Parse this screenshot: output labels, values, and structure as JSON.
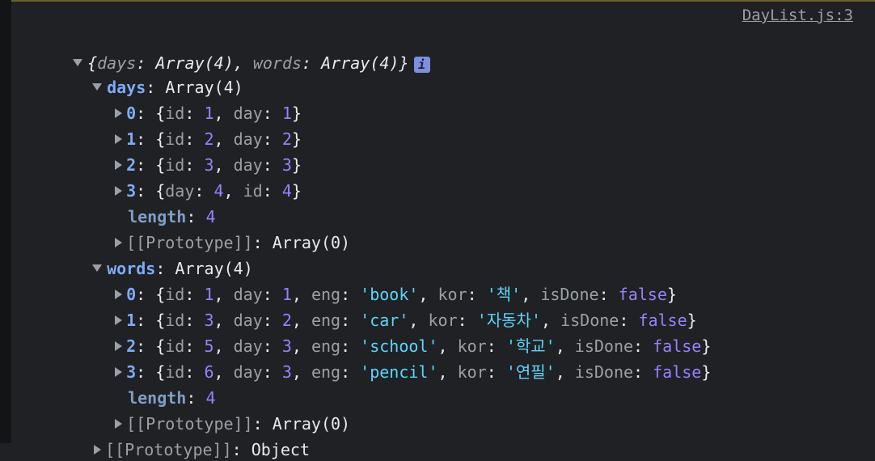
{
  "source_link": "DayList.js:3",
  "root_summary": {
    "open": "{",
    "days_key": "days",
    "days_val": "Array(4)",
    "words_key": "words",
    "words_val": "Array(4)",
    "close": "}",
    "info_icon": "i"
  },
  "days": {
    "key": "days",
    "value": "Array(4)",
    "items": [
      {
        "index": "0",
        "k1": "id",
        "v1": "1",
        "k2": "day",
        "v2": "1"
      },
      {
        "index": "1",
        "k1": "id",
        "v1": "2",
        "k2": "day",
        "v2": "2"
      },
      {
        "index": "2",
        "k1": "id",
        "v1": "3",
        "k2": "day",
        "v2": "3"
      },
      {
        "index": "3",
        "k1": "day",
        "v1": "4",
        "k2": "id",
        "v2": "4"
      }
    ],
    "length_key": "length",
    "length_val": "4",
    "proto_key": "[[Prototype]]",
    "proto_val": "Array(0)"
  },
  "words": {
    "key": "words",
    "value": "Array(4)",
    "items": [
      {
        "index": "0",
        "id": "1",
        "day": "1",
        "eng": "'book'",
        "kor": "'책'",
        "isDone": "false"
      },
      {
        "index": "1",
        "id": "3",
        "day": "2",
        "eng": "'car'",
        "kor": "'자동차'",
        "isDone": "false"
      },
      {
        "index": "2",
        "id": "5",
        "day": "3",
        "eng": "'school'",
        "kor": "'학교'",
        "isDone": "false"
      },
      {
        "index": "3",
        "id": "6",
        "day": "3",
        "eng": "'pencil'",
        "kor": "'연필'",
        "isDone": "false"
      }
    ],
    "length_key": "length",
    "length_val": "4",
    "proto_key": "[[Prototype]]",
    "proto_val": "Array(0)"
  },
  "root_proto": {
    "key": "[[Prototype]]",
    "value": "Object"
  },
  "labels": {
    "id": "id",
    "day": "day",
    "eng": "eng",
    "kor": "kor",
    "isDone": "isDone"
  }
}
